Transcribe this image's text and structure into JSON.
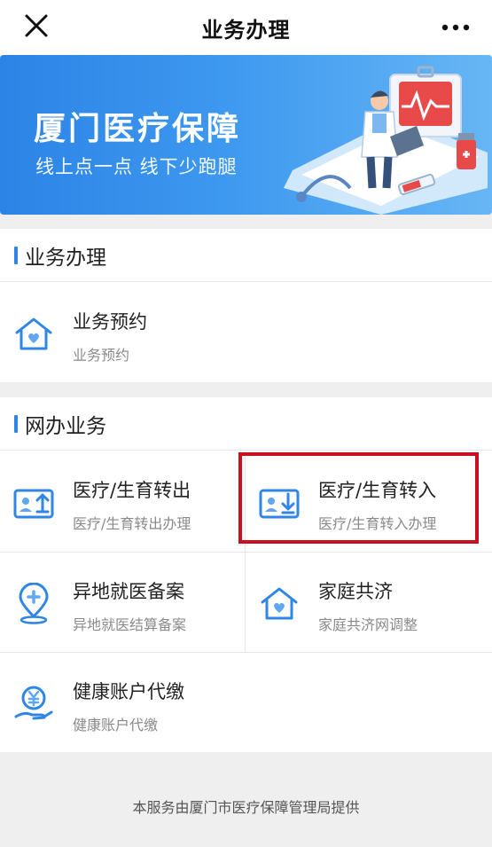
{
  "header": {
    "title": "业务办理",
    "close_icon": "close-icon",
    "more_icon": "more-icon"
  },
  "banner": {
    "title": "厦门医疗保障",
    "subtitle": "线上点一点 线下少跑腿"
  },
  "section1": {
    "heading": "业务办理",
    "items": [
      {
        "title": "业务预约",
        "subtitle": "业务预约",
        "icon": "house-heart-icon"
      }
    ]
  },
  "section2": {
    "heading": "网办业务",
    "items": [
      {
        "title": "医疗/生育转出",
        "subtitle": "医疗/生育转出办理",
        "icon": "card-upload-icon"
      },
      {
        "title": "医疗/生育转入",
        "subtitle": "医疗/生育转入办理",
        "icon": "card-download-icon"
      },
      {
        "title": "异地就医备案",
        "subtitle": "异地就医结算备案",
        "icon": "location-plus-icon"
      },
      {
        "title": "家庭共济",
        "subtitle": "家庭共济网调整",
        "icon": "house-heart-icon"
      },
      {
        "title": "健康账户代缴",
        "subtitle": "健康账户代缴",
        "icon": "yuan-hand-icon"
      }
    ]
  },
  "footer": {
    "text": "本服务由厦门市医疗保障管理局提供"
  },
  "colors": {
    "accent": "#2f86e6",
    "highlight": "#c8101e"
  }
}
